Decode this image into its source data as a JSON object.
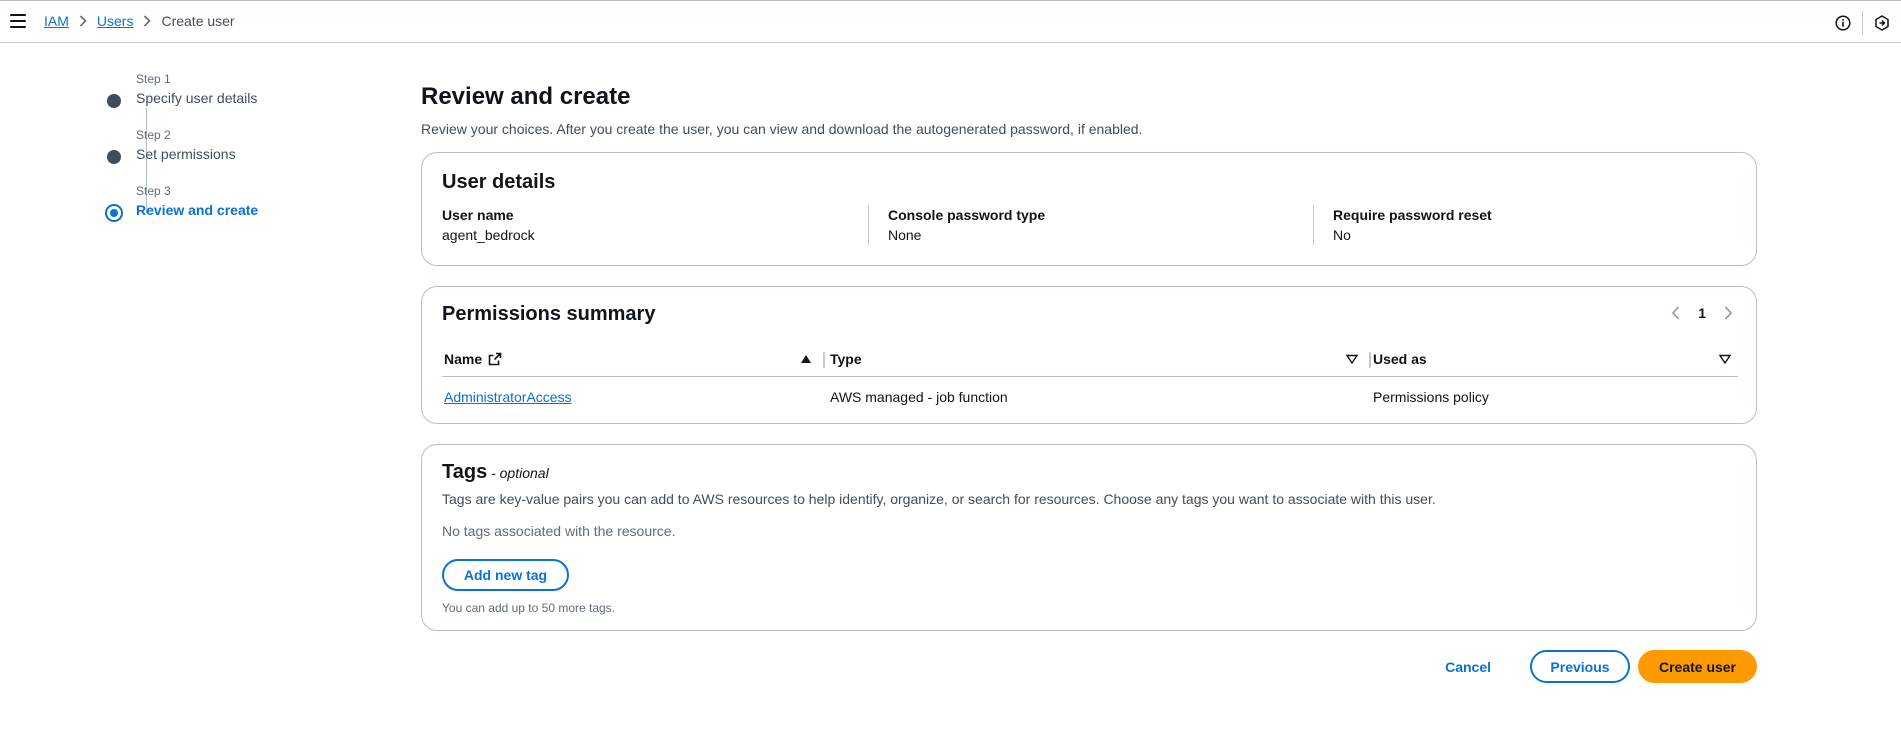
{
  "breadcrumb": {
    "items": [
      "IAM",
      "Users"
    ],
    "current": "Create user"
  },
  "icons": {
    "menu": "hamburger-icon",
    "separator": "chevron-right-icon",
    "info": "info-icon",
    "settings": "hexagon-settings-icon"
  },
  "wizard": {
    "steps": [
      {
        "number": "Step 1",
        "label": "Specify user details"
      },
      {
        "number": "Step 2",
        "label": "Set permissions"
      },
      {
        "number": "Step 3",
        "label": "Review and create"
      }
    ]
  },
  "page": {
    "title": "Review and create",
    "description": "Review your choices. After you create the user, you can view and download the autogenerated password, if enabled."
  },
  "user_details": {
    "title": "User details",
    "fields": [
      {
        "label": "User name",
        "value": "agent_bedrock"
      },
      {
        "label": "Console password type",
        "value": "None"
      },
      {
        "label": "Require password reset",
        "value": "No"
      }
    ]
  },
  "permissions": {
    "title": "Permissions summary",
    "page": "1",
    "columns": [
      "Name",
      "Type",
      "Used as"
    ],
    "rows": [
      {
        "name": "AdministratorAccess",
        "type": "AWS managed - job function",
        "used_as": "Permissions policy"
      }
    ]
  },
  "tags": {
    "title": "Tags",
    "optional": " - optional",
    "description": "Tags are key-value pairs you can add to AWS resources to help identify, organize, or search for resources. Choose any tags you want to associate with this user.",
    "empty": "No tags associated with the resource.",
    "add_button": "Add new tag",
    "hint": "You can add up to 50 more tags."
  },
  "actions": {
    "cancel": "Cancel",
    "previous": "Previous",
    "create": "Create user"
  },
  "colors": {
    "link": "#0972d3",
    "primary": "#ff9900",
    "border": "#b6bec9"
  }
}
